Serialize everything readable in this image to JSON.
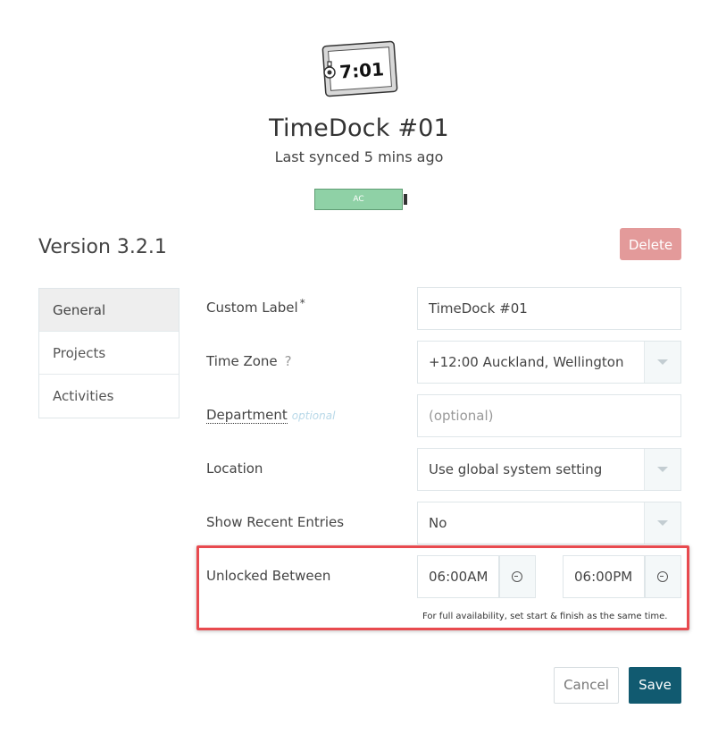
{
  "device": {
    "icon_time": "7:01",
    "title": "TimeDock #01",
    "synced": "Last synced 5 mins ago",
    "battery_label": "AC"
  },
  "version": "Version 3.2.1",
  "delete_label": "Delete",
  "nav": {
    "items": [
      {
        "label": "General",
        "active": true
      },
      {
        "label": "Projects"
      },
      {
        "label": "Activities"
      }
    ]
  },
  "form": {
    "custom_label": {
      "label": "Custom Label",
      "required": "*",
      "value": "TimeDock #01"
    },
    "time_zone": {
      "label": "Time Zone",
      "help": "?",
      "value": "+12:00 Auckland, Wellington"
    },
    "department": {
      "label": "Department",
      "hint": "optional",
      "placeholder": "(optional)"
    },
    "location": {
      "label": "Location",
      "value": "Use global system setting"
    },
    "show_recent": {
      "label": "Show Recent Entries",
      "value": "No"
    },
    "unlocked": {
      "label": "Unlocked Between",
      "start": "06:00AM",
      "finish": "06:00PM",
      "hint": "For full availability, set start & finish as the same time."
    }
  },
  "actions": {
    "cancel": "Cancel",
    "save": "Save"
  },
  "colors": {
    "delete": "#e39a9a",
    "save": "#115a70",
    "battery": "#8fd1a6",
    "highlight": "#e84a4f"
  }
}
